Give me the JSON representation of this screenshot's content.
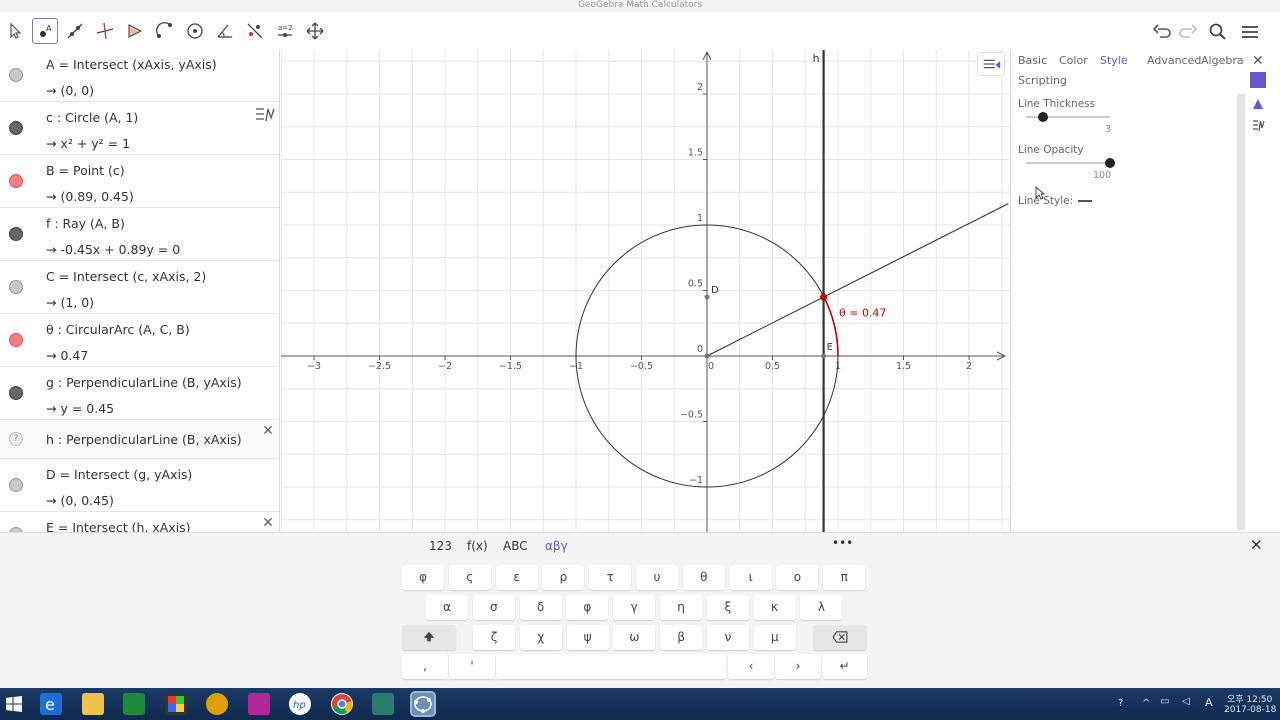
{
  "window": {
    "title": "GeoGebra Math Calculators"
  },
  "toolbar": {
    "tools": [
      "move-tool",
      "point-tool",
      "line-tool",
      "perpendicular-line-tool",
      "polygon-tool",
      "circle-with-center-tool",
      "circle-tool",
      "angle-tool",
      "reflect-tool",
      "slider-tool",
      "move-graphics-view-tool"
    ],
    "selected_tool": "point-tool"
  },
  "algebra": {
    "rows": [
      {
        "def": "A = Intersect (xAxis, yAxis)",
        "val": "→ (0, 0)",
        "marble": "#c8c8c8"
      },
      {
        "def": "c : Circle (A, 1)",
        "val": "→ x² + y² = 1",
        "marble": "#666666"
      },
      {
        "def": "B = Point (c)",
        "val": "→ (0.89, 0.45)",
        "marble": "#f08080"
      },
      {
        "def": "f : Ray (A, B)",
        "val": "→ -0.45x + 0.89y = 0",
        "marble": "#666666"
      },
      {
        "def": "C = Intersect (c, xAxis, 2)",
        "val": "→ (1, 0)",
        "marble": "#c8c8c8"
      },
      {
        "def": "θ : CircularArc (A, C, B)",
        "val": "→ 0.47",
        "marble": "#f08080"
      },
      {
        "def": "g : PerpendicularLine (B, yAxis)",
        "val": "→ y = 0.45",
        "marble": "#666666"
      },
      {
        "def": "h : PerpendicularLine (B, xAxis)",
        "val": "",
        "marble": "help"
      },
      {
        "def": "D = Intersect (g, yAxis)",
        "val": "→ (0, 0.45)",
        "marble": "#c8c8c8"
      },
      {
        "def": "E = Intersect (h, xAxis)",
        "val": "",
        "marble": "#c8c8c8"
      }
    ]
  },
  "graphics": {
    "x_ticks": [
      "−3",
      "−2.5",
      "−2",
      "−1.5",
      "−1",
      "−0.5",
      "0",
      "0.5",
      "1",
      "1.5",
      "2"
    ],
    "y_ticks": [
      "2",
      "1.5",
      "1",
      "0.5",
      "0",
      "−0.5",
      "−1"
    ],
    "labels": {
      "h": "h",
      "D": "D",
      "E": "E",
      "theta": "θ = 0.47"
    },
    "colors": {
      "arc": "#cc0000",
      "point_B": "#cc0000",
      "grid": "#e6e6e6"
    }
  },
  "properties": {
    "tabs": [
      "Basic",
      "Color",
      "Style",
      "Advanced",
      "Algebra",
      "Scripting"
    ],
    "active_tab": "Style",
    "line_thickness_label": "Line Thickness",
    "line_thickness_value": "3",
    "line_thickness_fraction": 0.2,
    "line_opacity_label": "Line Opacity",
    "line_opacity_value": "100",
    "line_opacity_fraction": 1.0,
    "line_style_label": "Line Style:"
  },
  "keyboard": {
    "tabs": [
      "123",
      "f(x)",
      "ABC",
      "αβγ"
    ],
    "active_tab": "αβγ",
    "more": "•••",
    "row1": [
      "φ",
      "ς",
      "ε",
      "ρ",
      "τ",
      "υ",
      "θ",
      "ι",
      "ο",
      "π"
    ],
    "row2": [
      "α",
      "σ",
      "δ",
      "φ",
      "γ",
      "η",
      "ξ",
      "κ",
      "λ"
    ],
    "row3": [
      "ζ",
      "χ",
      "ψ",
      "ω",
      "β",
      "ν",
      "μ"
    ],
    "row4": [
      ",",
      "'"
    ]
  },
  "taskbar": {
    "time": "오후 12:50",
    "date": "2017-08-18",
    "ime": "A"
  }
}
